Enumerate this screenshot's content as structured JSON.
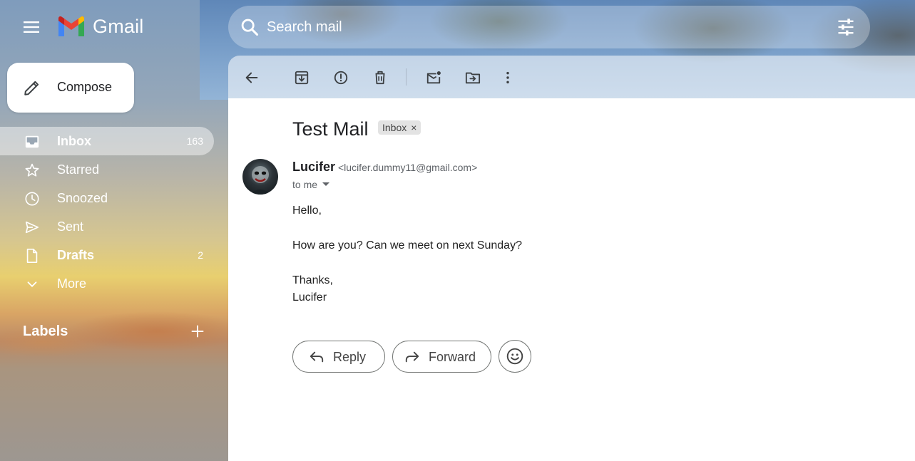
{
  "app": {
    "name": "Gmail"
  },
  "search": {
    "placeholder": "Search mail"
  },
  "compose": {
    "label": "Compose"
  },
  "sidebar": {
    "items": [
      {
        "label": "Inbox",
        "count": "163",
        "icon": "inbox-icon"
      },
      {
        "label": "Starred",
        "count": "",
        "icon": "star-icon"
      },
      {
        "label": "Snoozed",
        "count": "",
        "icon": "clock-icon"
      },
      {
        "label": "Sent",
        "count": "",
        "icon": "send-icon"
      },
      {
        "label": "Drafts",
        "count": "2",
        "icon": "draft-icon"
      },
      {
        "label": "More",
        "count": "",
        "icon": "chevron-down-icon"
      }
    ],
    "labels_heading": "Labels"
  },
  "email": {
    "subject": "Test Mail",
    "label_badge": "Inbox",
    "sender_name": "Lucifer",
    "sender_email": "<lucifer.dummy11@gmail.com>",
    "recipient": "to me",
    "body": {
      "greeting": "Hello,",
      "line1": "How are you? Can we meet on next Sunday?",
      "closing": "Thanks,",
      "signature": "Lucifer"
    }
  },
  "actions": {
    "reply": "Reply",
    "forward": "Forward"
  },
  "colors": {
    "gmail_red": "#ea4335",
    "gmail_blue": "#4285f4",
    "gmail_green": "#34a853",
    "gmail_yellow": "#fbbc04"
  }
}
